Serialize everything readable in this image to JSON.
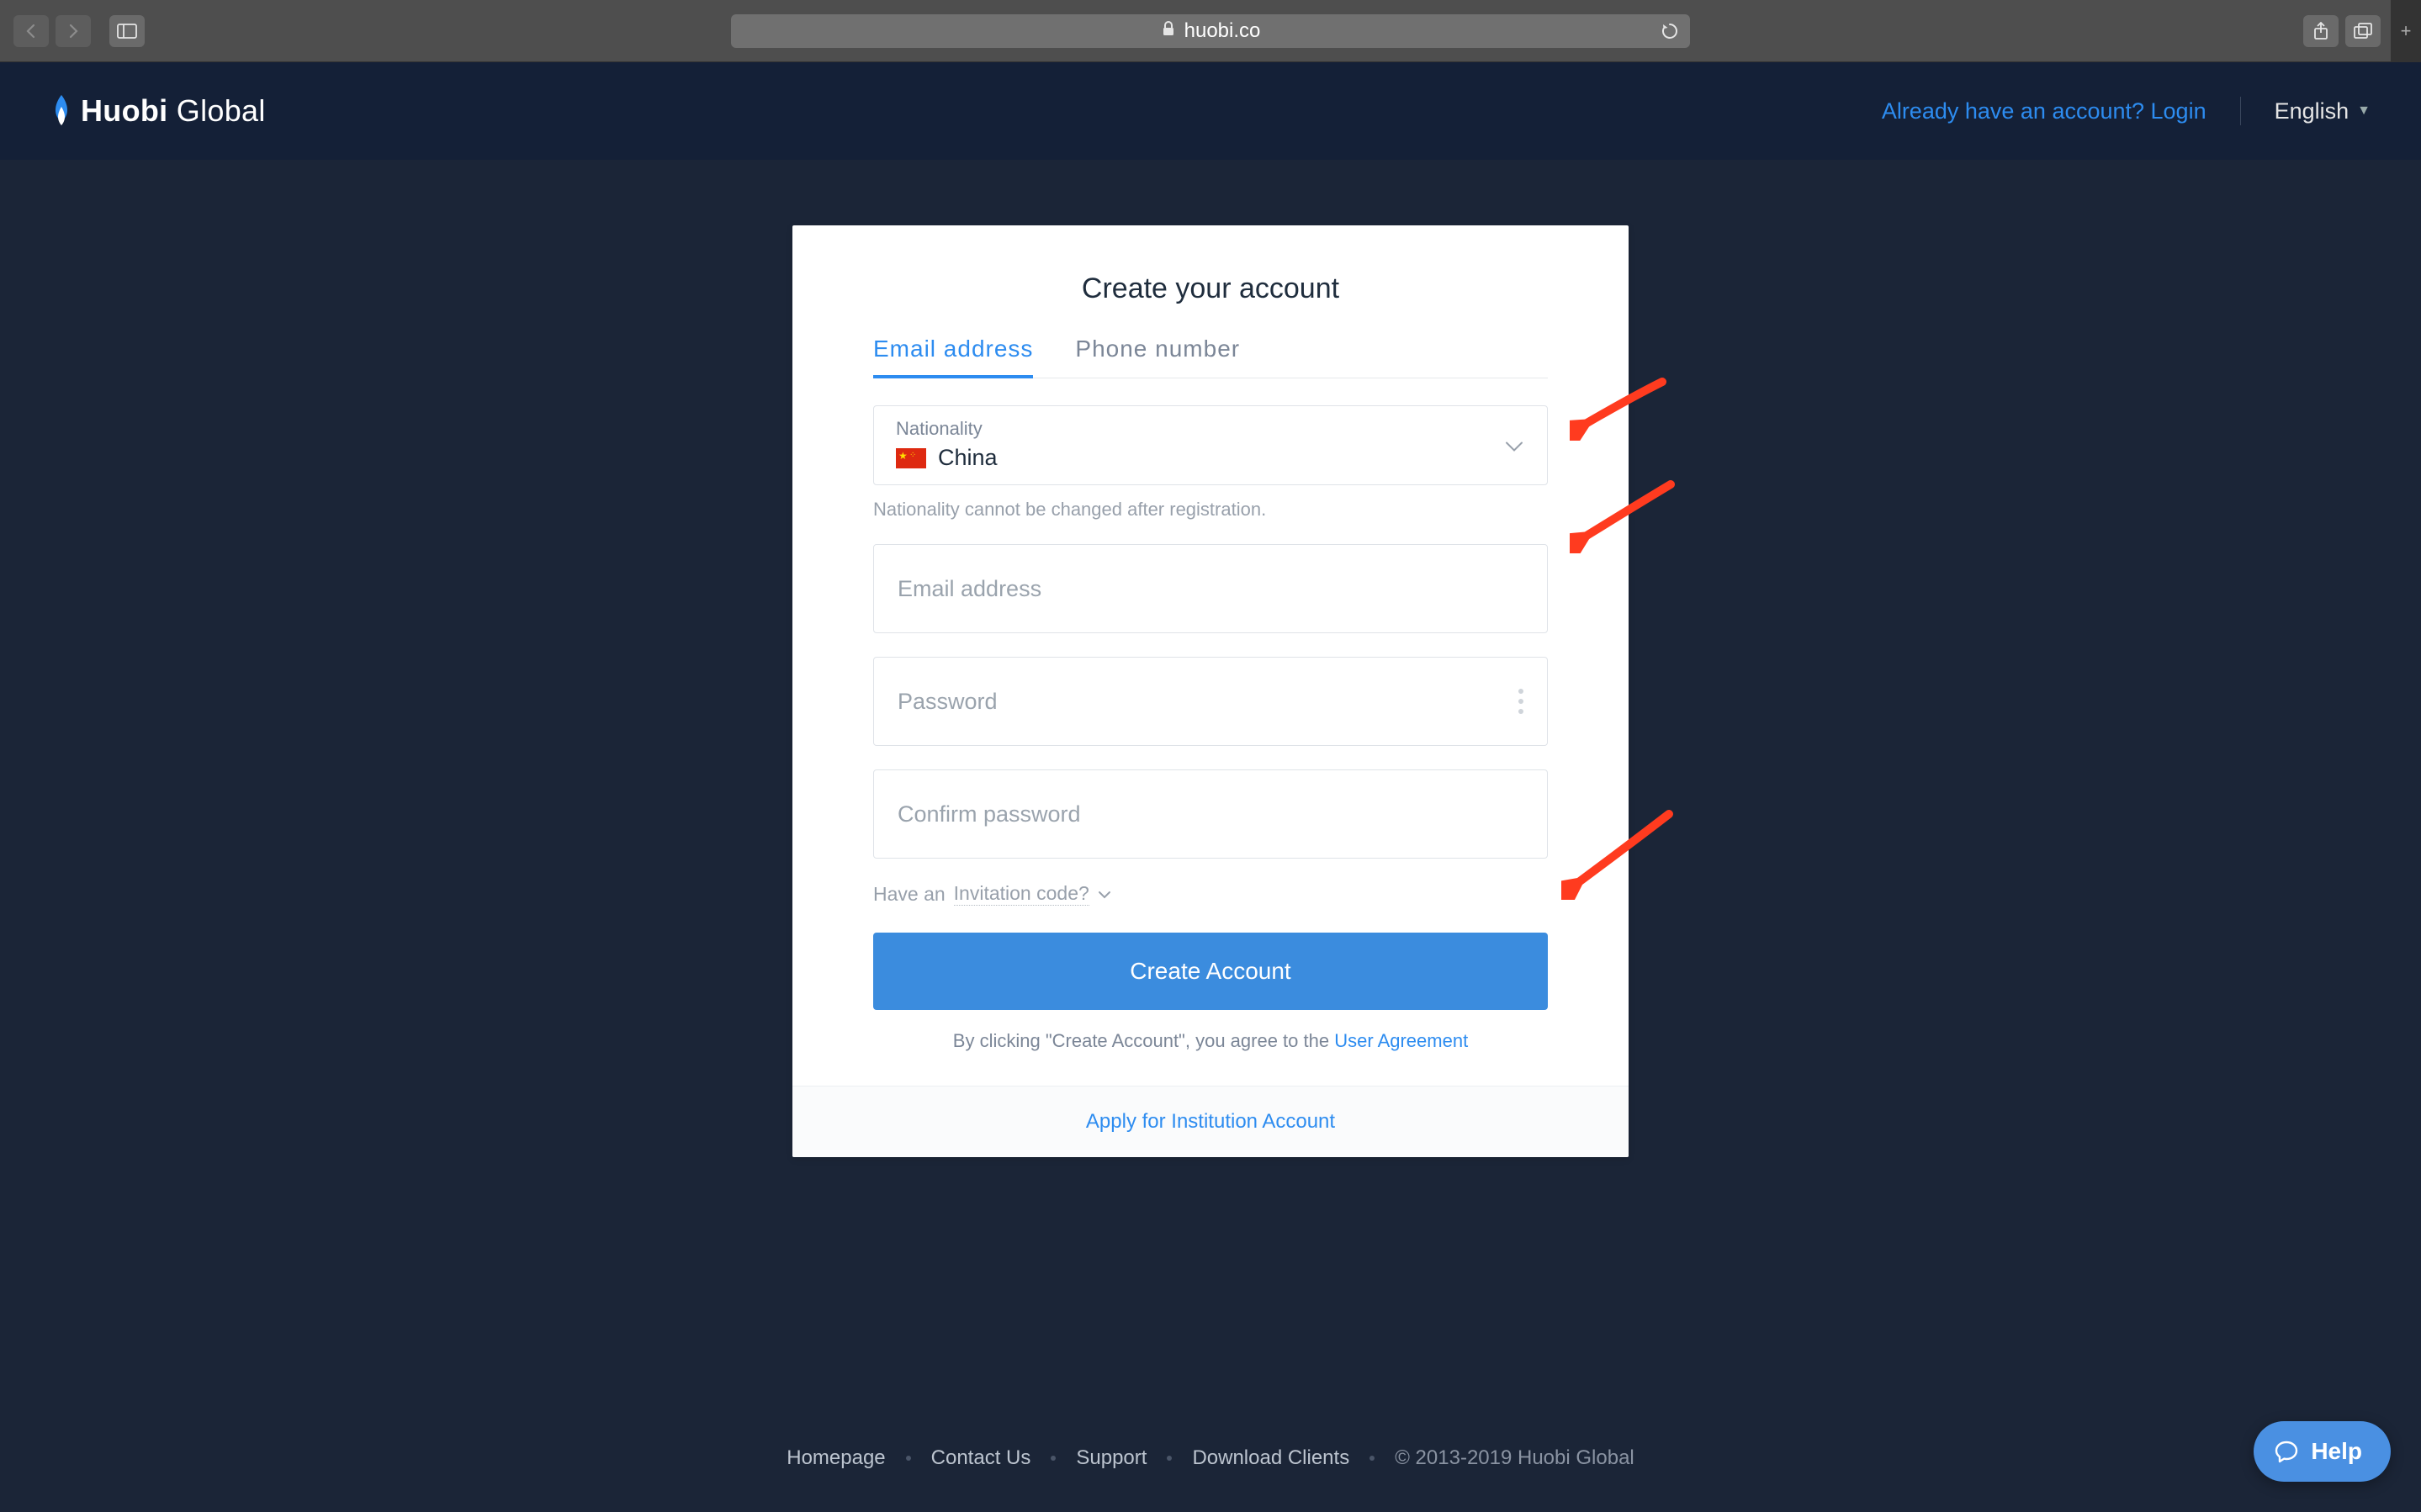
{
  "browser": {
    "url": "huobi.co"
  },
  "header": {
    "brand_first": "Huobi",
    "brand_second": "Global",
    "login_prompt": "Already have an account? Login",
    "language": "English"
  },
  "form": {
    "title": "Create your account",
    "tabs": {
      "email": "Email address",
      "phone": "Phone number"
    },
    "nationality": {
      "label": "Nationality",
      "value": "China",
      "hint": "Nationality cannot be changed after registration."
    },
    "email_placeholder": "Email address",
    "password_placeholder": "Password",
    "confirm_placeholder": "Confirm password",
    "invite_prefix": "Have an ",
    "invite_link": "Invitation code?",
    "submit": "Create Account",
    "agree_prefix": "By clicking \"Create Account\",  you agree to the ",
    "agree_link": "User Agreement",
    "institution_link": "Apply for Institution Account"
  },
  "footer": {
    "links": [
      "Homepage",
      "Contact Us",
      "Support",
      "Download Clients"
    ],
    "copyright": "© 2013-2019 Huobi Global"
  },
  "help": {
    "label": "Help"
  }
}
